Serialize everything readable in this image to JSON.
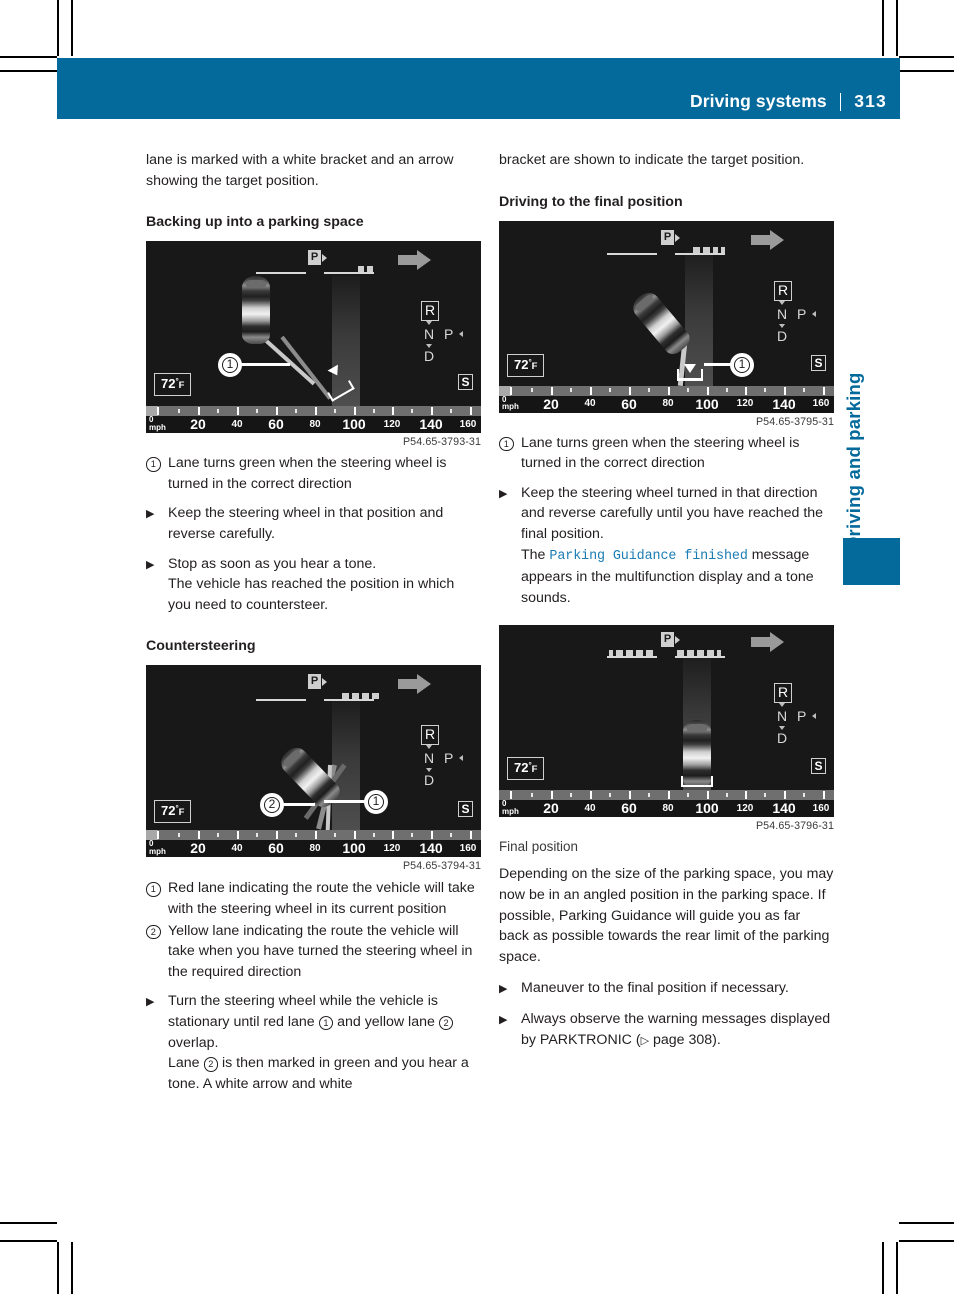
{
  "header": {
    "title": "Driving systems",
    "page_number": "313"
  },
  "side_tab": {
    "label": "Driving and parking"
  },
  "left_column": {
    "intro": "lane is marked with a white bracket and an arrow showing the target position.",
    "heading_1": "Backing up into a parking space",
    "figure_1": {
      "caption": "P54.65-3793-31",
      "temperature": "72",
      "degree": "°",
      "unit": "F",
      "sport_mode": "S",
      "gear_selected": "R",
      "gear_n": "N",
      "gear_p": "P",
      "gear_d": "D",
      "park_marker": "P",
      "speed_labels": [
        "20",
        "40",
        "60",
        "80",
        "100",
        "120",
        "140",
        "160"
      ],
      "zero_label_top": "0",
      "zero_label_bottom": "mph",
      "callouts": [
        "1"
      ]
    },
    "items_1": [
      {
        "marker": "1",
        "marker_type": "numcircle",
        "text": "Lane turns green when the steering wheel is turned in the correct direction"
      },
      {
        "marker": "▶",
        "marker_type": "triangle",
        "text": "Keep the steering wheel in that position and reverse carefully."
      },
      {
        "marker": "▶",
        "marker_type": "triangle",
        "text": "Stop as soon as you hear a tone.\nThe vehicle has reached the position in which you need to countersteer."
      }
    ],
    "heading_2": "Countersteering",
    "figure_2": {
      "caption": "P54.65-3794-31",
      "temperature": "72",
      "degree": "°",
      "unit": "F",
      "sport_mode": "S",
      "gear_selected": "R",
      "gear_n": "N",
      "gear_p": "P",
      "gear_d": "D",
      "park_marker": "P",
      "speed_labels": [
        "20",
        "40",
        "60",
        "80",
        "100",
        "120",
        "140",
        "160"
      ],
      "zero_label_top": "0",
      "zero_label_bottom": "mph",
      "callouts": [
        "1",
        "2"
      ]
    },
    "items_2": [
      {
        "marker": "1",
        "marker_type": "numcircle",
        "text": "Red lane indicating the route the vehicle will take with the steering wheel in its current position"
      },
      {
        "marker": "2",
        "marker_type": "numcircle",
        "text": "Yellow lane indicating the route the vehicle will take when you have turned the steering wheel in the required direction"
      }
    ],
    "turn_step": {
      "part_a": "Turn the steering wheel while the vehicle is stationary until red lane ",
      "ref_1": "1",
      "part_b": " and yellow lane ",
      "ref_2": "2",
      "part_c": " overlap.",
      "part_d": "Lane ",
      "ref_3": "2",
      "part_e": " is then marked in green and you hear a tone. A white arrow and white"
    }
  },
  "right_column": {
    "intro": "bracket are shown to indicate the target position.",
    "heading_1": "Driving to the final position",
    "figure_1": {
      "caption": "P54.65-3795-31",
      "temperature": "72",
      "degree": "°",
      "unit": "F",
      "sport_mode": "S",
      "gear_selected": "R",
      "gear_n": "N",
      "gear_p": "P",
      "gear_d": "D",
      "park_marker": "P",
      "speed_labels": [
        "20",
        "40",
        "60",
        "80",
        "100",
        "120",
        "140",
        "160"
      ],
      "zero_label_top": "0",
      "zero_label_bottom": "mph",
      "callouts": [
        "1"
      ]
    },
    "items_1": [
      {
        "marker": "1",
        "marker_type": "numcircle",
        "text": "Lane turns green when the steering wheel is turned in the correct direction"
      }
    ],
    "keep_step": {
      "part_a": "Keep the steering wheel turned in that direction and reverse carefully until you have reached the final position.",
      "part_b": "The ",
      "mono": "Parking Guidance finished",
      "part_c": " message appears in the multifunction display and a tone sounds."
    },
    "figure_2": {
      "caption": "P54.65-3796-31",
      "label": "Final position",
      "temperature": "72",
      "degree": "°",
      "unit": "F",
      "sport_mode": "S",
      "gear_selected": "R",
      "gear_n": "N",
      "gear_p": "P",
      "gear_d": "D",
      "park_marker": "P",
      "speed_labels": [
        "20",
        "40",
        "60",
        "80",
        "100",
        "120",
        "140",
        "160"
      ],
      "zero_label_top": "0",
      "zero_label_bottom": "mph",
      "callouts": []
    },
    "paragraph": "Depending on the size of the parking space, you may now be in an angled position in the parking space. If possible, Parking Guidance will guide you as far back as possible towards the rear limit of the parking space.",
    "items_2": [
      {
        "marker": "▶",
        "marker_type": "triangle",
        "text": "Maneuver to the final position if necessary."
      }
    ],
    "pktronic_step": {
      "part_a": "Always observe the warning messages displayed by PARKTRONIC (",
      "ref_icon": "▷",
      "part_b": " page 308)."
    }
  },
  "colors": {
    "brand_blue": "#046a9c",
    "mono_blue": "#1b7cb3",
    "text": "#231f20",
    "display_bg": "#1c1c1c"
  }
}
